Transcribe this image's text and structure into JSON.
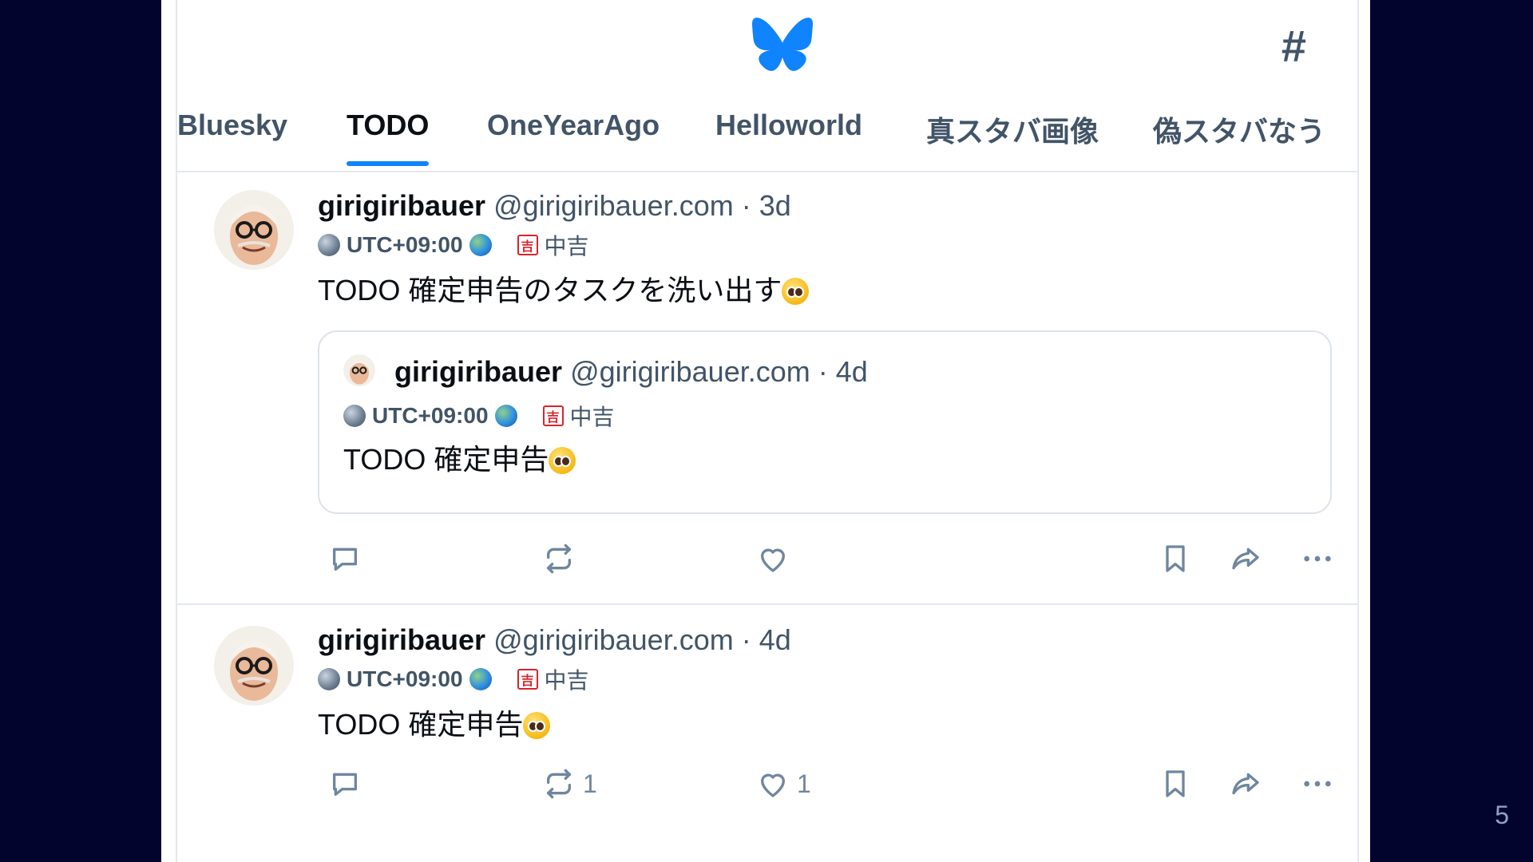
{
  "page_number": "5",
  "colors": {
    "accent": "#1083fe",
    "background": "#02042e",
    "text_secondary": "#425467"
  },
  "header": {
    "logo_icon": "butterfly-icon",
    "feeds_icon": "hash-icon",
    "feeds_symbol": "#"
  },
  "tabs": [
    {
      "label": "Bluesky",
      "active": false
    },
    {
      "label": "TODO",
      "active": true
    },
    {
      "label": "OneYearAgo",
      "active": false
    },
    {
      "label": "Helloworld",
      "active": false
    },
    {
      "label": "真スタバ画像",
      "active": false
    },
    {
      "label": "偽スタバなう",
      "active": false
    }
  ],
  "posts": [
    {
      "author": "girigiribauer",
      "handle": "@girigiribauer.com",
      "separator": "·",
      "time": "3d",
      "timezone": "UTC+09:00",
      "fortune_badge": "吉",
      "fortune": "中吉",
      "text": "TODO 確定申告のタスクを洗い出す",
      "quote": {
        "author": "girigiribauer",
        "handle": "@girigiribauer.com",
        "separator": "·",
        "time": "4d",
        "timezone": "UTC+09:00",
        "fortune_badge": "吉",
        "fortune": "中吉",
        "text": "TODO 確定申告"
      },
      "reposts": "",
      "likes": ""
    },
    {
      "author": "girigiribauer",
      "handle": "@girigiribauer.com",
      "separator": "·",
      "time": "4d",
      "timezone": "UTC+09:00",
      "fortune_badge": "吉",
      "fortune": "中吉",
      "text": "TODO 確定申告",
      "reposts": "1",
      "likes": "1"
    }
  ]
}
